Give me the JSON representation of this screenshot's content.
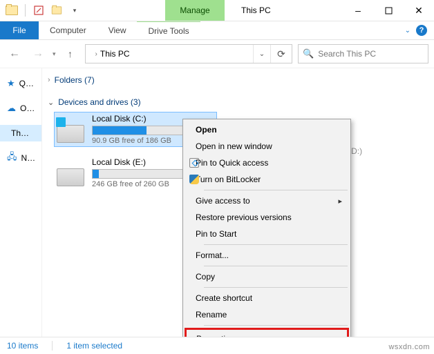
{
  "titlebar": {
    "manage_label": "Manage",
    "title": "This PC"
  },
  "ribbon": {
    "file": "File",
    "tabs": [
      "Computer",
      "View",
      "Drive Tools"
    ]
  },
  "nav": {
    "location": "This PC",
    "search_placeholder": "Search This PC"
  },
  "sidebar": {
    "items": [
      {
        "label": "Q…",
        "kind": "quick-access"
      },
      {
        "label": "O…",
        "kind": "onedrive"
      },
      {
        "label": "Th…",
        "kind": "this-pc"
      },
      {
        "label": "N…",
        "kind": "network"
      }
    ]
  },
  "groups": {
    "folders_label": "Folders (7)",
    "drives_label": "Devices and drives (3)"
  },
  "drives": [
    {
      "label": "Local Disk (C:)",
      "free_text": "90.9 GB free of 186 GB",
      "fill_percent": 52,
      "primary": true
    },
    {
      "label": "Local Disk (E:)",
      "free_text": "246 GB free of 260 GB",
      "fill_percent": 6,
      "primary": false
    }
  ],
  "dvd": {
    "label": "DVD RW Drive (D:)"
  },
  "context_menu": {
    "open": "Open",
    "open_new_window": "Open in new window",
    "pin_quick_access": "Pin to Quick access",
    "bitlocker": "Turn on BitLocker",
    "give_access": "Give access to",
    "restore_prev": "Restore previous versions",
    "pin_start": "Pin to Start",
    "format": "Format...",
    "copy": "Copy",
    "create_shortcut": "Create shortcut",
    "rename": "Rename",
    "properties": "Properties"
  },
  "status": {
    "items": "10 items",
    "selected": "1 item selected"
  },
  "watermark": "wsxdn.com"
}
